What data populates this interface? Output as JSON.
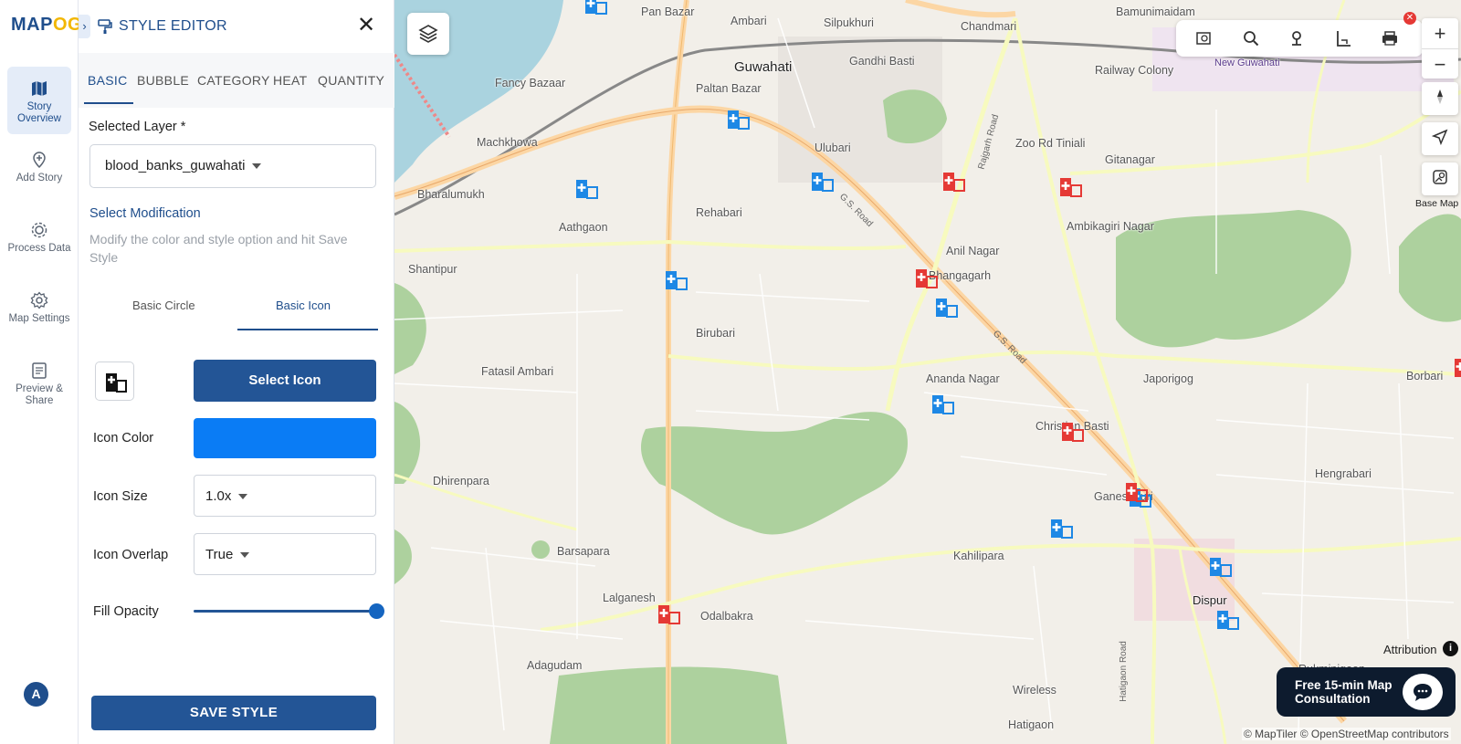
{
  "brand": {
    "part1": "MAP",
    "part2": "OG"
  },
  "rail": {
    "items": [
      {
        "label": "Story Overview",
        "icon": "map-book-icon"
      },
      {
        "label": "Add Story",
        "icon": "location-pin-add-icon"
      },
      {
        "label": "Process Data",
        "icon": "gear-process-icon"
      },
      {
        "label": "Map Settings",
        "icon": "settings-icon"
      },
      {
        "label": "Preview & Share",
        "icon": "preview-share-icon"
      }
    ],
    "avatar": "A"
  },
  "panel": {
    "title": "STYLE EDITOR",
    "tabs": [
      "BASIC",
      "BUBBLE",
      "CATEGORY",
      "HEAT",
      "QUANTITY"
    ],
    "selected_layer_label": "Selected Layer *",
    "selected_layer": "blood_banks_guwahati",
    "modification_title": "Select Modification",
    "modification_desc": "Modify the color and style option and hit Save Style",
    "subtabs": [
      "Basic Circle",
      "Basic Icon"
    ],
    "select_icon_label": "Select Icon",
    "icon_color_label": "Icon Color",
    "icon_color": "#0a7cf5",
    "icon_size_label": "Icon Size",
    "icon_size": "1.0x",
    "icon_overlap_label": "Icon Overlap",
    "icon_overlap": "True",
    "fill_opacity_label": "Fill Opacity",
    "fill_opacity": 1.0,
    "save_label": "SAVE STYLE"
  },
  "map": {
    "places": [
      "Pan Bazar",
      "Ambari",
      "Silpukhuri",
      "Chandmari",
      "Bamunimaidam",
      "Guwahati",
      "Gandhi Basti",
      "Railway Colony",
      "New Guwahati",
      "Fancy Bazaar",
      "Paltan Bazar",
      "Machkhowa",
      "Ulubari",
      "Zoo Rd Tiniali",
      "Gitanagar",
      "Bharalumukh",
      "Aathgaon",
      "Rehabari",
      "Ambikagiri Nagar",
      "Anil Nagar",
      "Shantipur",
      "Bhangagarh",
      "Birubari",
      "Fatasil Ambari",
      "Ananda Nagar",
      "Japorigog",
      "Borbari",
      "Christian Basti",
      "Dhirenpara",
      "Ganeshguri",
      "Hengrabari",
      "Barsapara",
      "Kahilipara",
      "Dispur",
      "Lalganesh",
      "Odalbakra",
      "Adagudam",
      "Wireless",
      "Hatigaon",
      "Rukminigaon"
    ],
    "roads": [
      "Rajgarh Road",
      "G.S. Road",
      "G.S. Road",
      "Hatigaon Road"
    ],
    "markers": {
      "blue_color": "#1e88e5",
      "red_color": "#e53935"
    },
    "toolbar_icons": [
      "map-search-icon",
      "search-icon",
      "pin-icon",
      "measure-icon",
      "print-icon"
    ],
    "controls": [
      "zoom-in",
      "zoom-out",
      "compass",
      "locate"
    ],
    "basemap_label": "Base Map",
    "attribution_label": "Attribution",
    "consultation": "Free 15-min Map Consultation",
    "copyright": "© MapTiler © OpenStreetMap contributors"
  }
}
